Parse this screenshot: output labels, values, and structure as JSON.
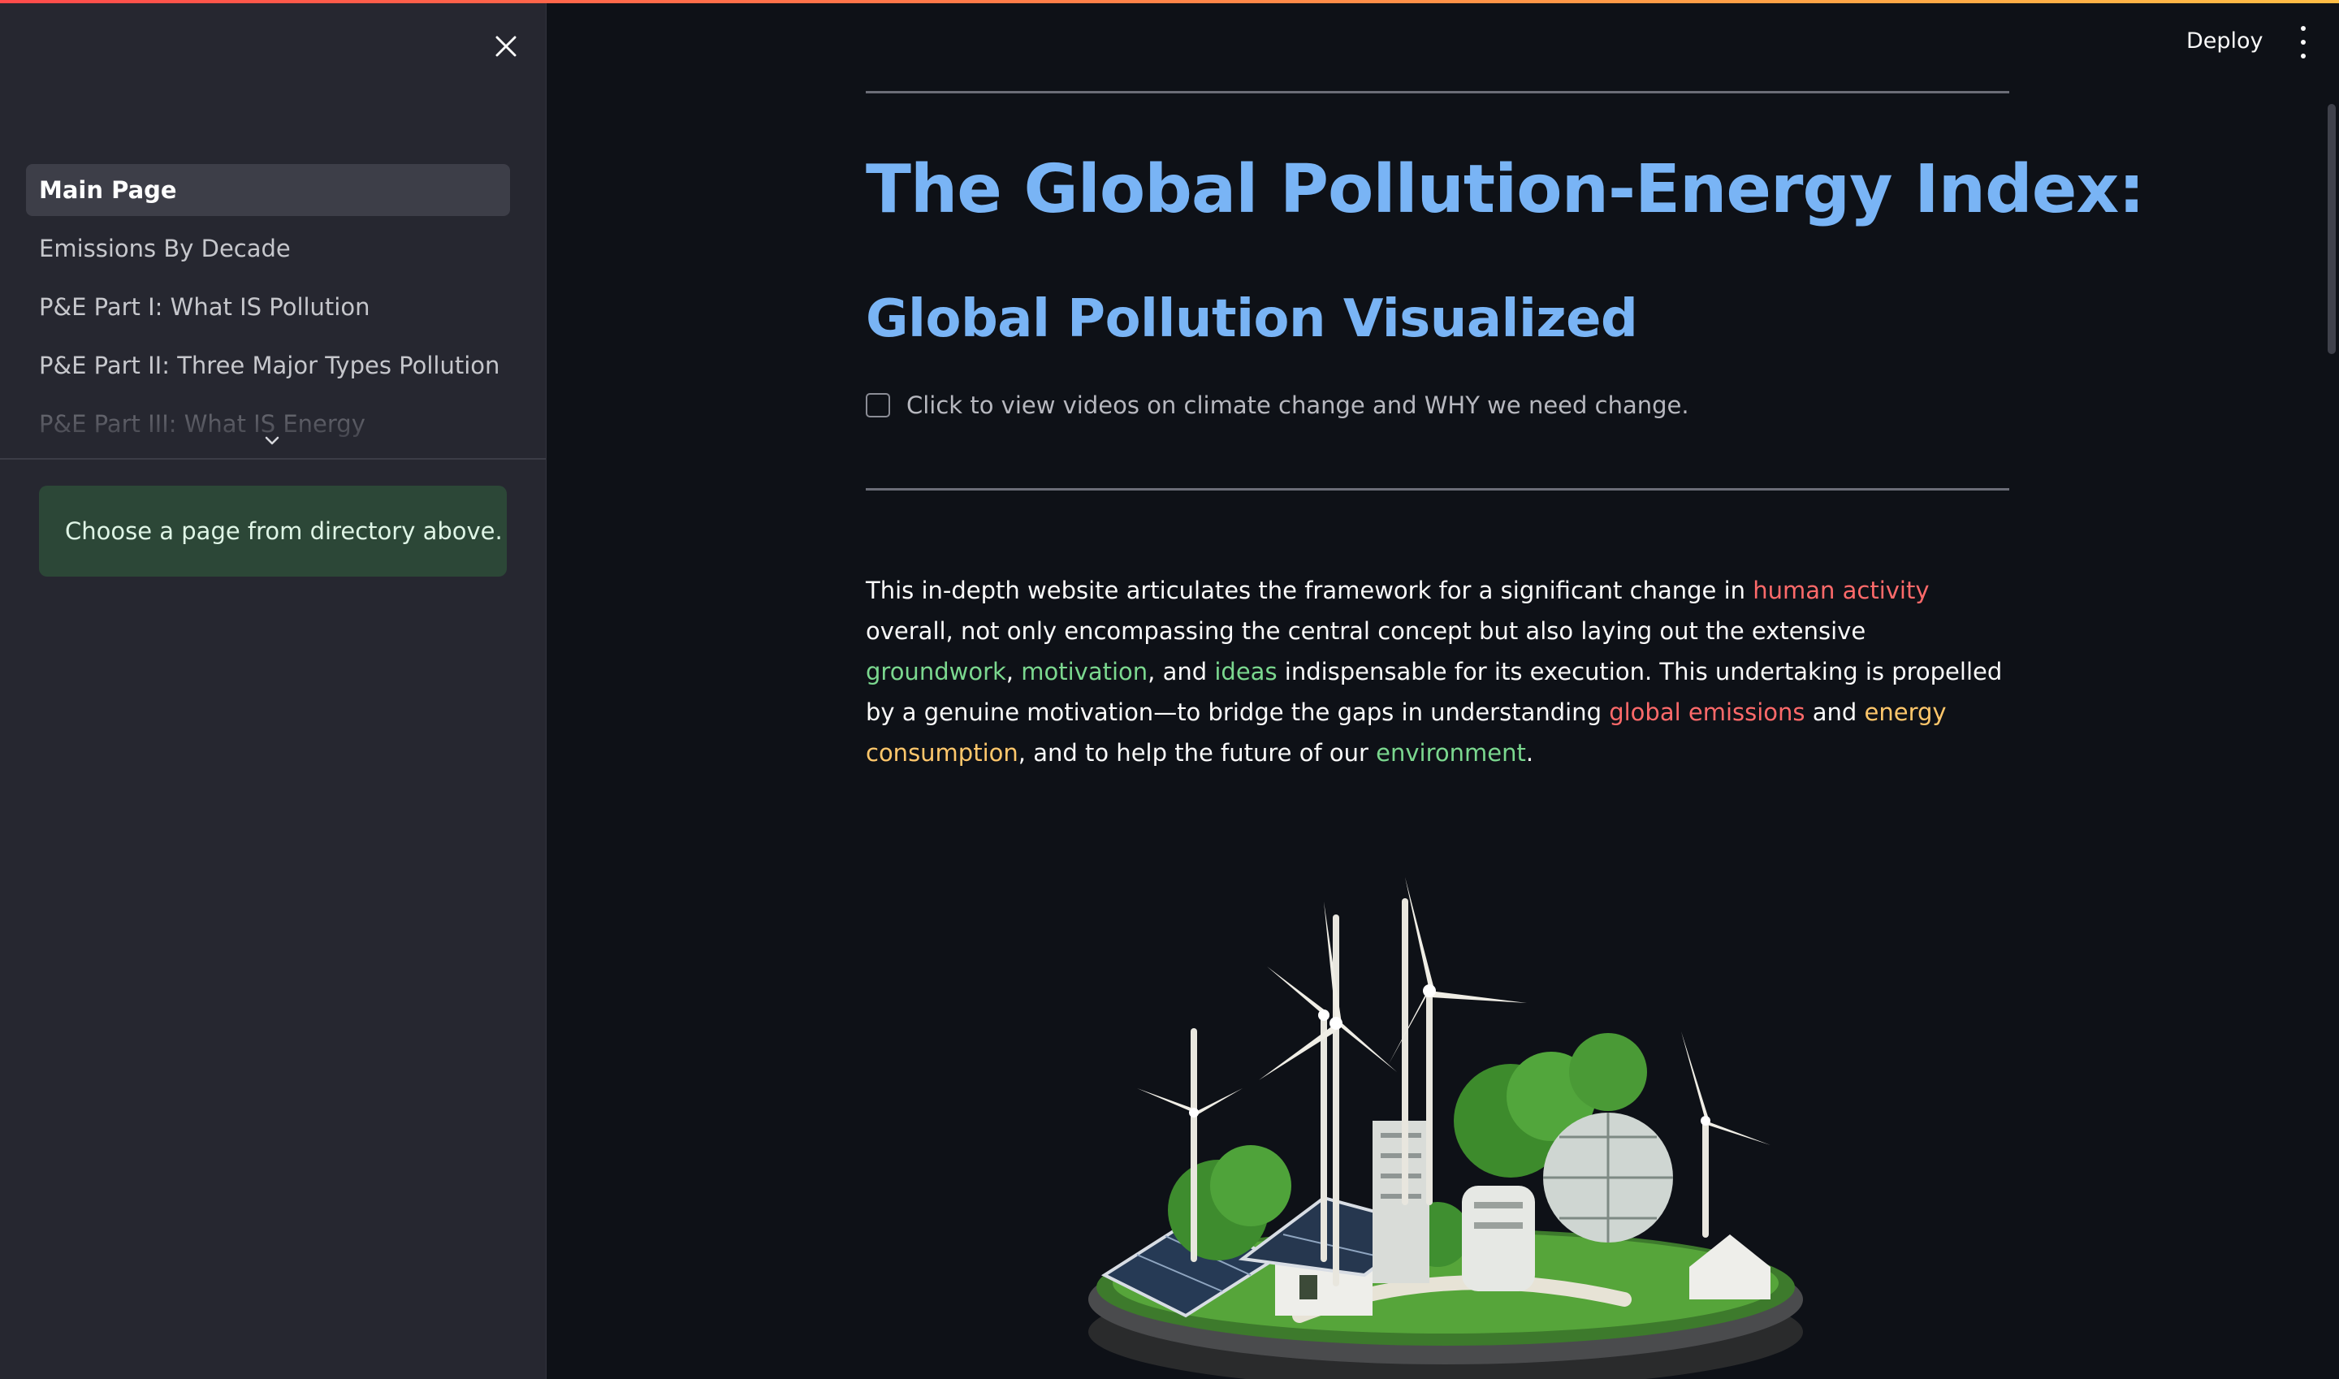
{
  "sidebar": {
    "nav_items": [
      {
        "label": "Main Page"
      },
      {
        "label": "Emissions By Decade"
      },
      {
        "label": "P&E Part I: What IS Pollution"
      },
      {
        "label": "P&E Part II: Three Major Types Pollution"
      },
      {
        "label": "P&E Part III: What IS Energy"
      }
    ],
    "info_message": "Choose a page from directory above."
  },
  "header": {
    "deploy_label": "Deploy"
  },
  "main": {
    "title": "The Global Pollution-Energy Index:",
    "subtitle": "Global Pollution Visualized",
    "checkbox_label": "Click to view videos on climate change and WHY we need change.",
    "intro": {
      "p1": "This in-depth website articulates the framework for a significant change in ",
      "h1": "human activity",
      "p2": " overall, not only encompassing the central concept but also laying out the extensive ",
      "h2": "groundwork",
      "p3": ", ",
      "h3": "motivation",
      "p4": ", and ",
      "h4": "ideas",
      "p5": " indispensable for its execution. This undertaking is propelled by a genuine motivation—to bridge the gaps in understanding ",
      "h5": "global emissions",
      "p6": " and ",
      "h6": "energy consumption",
      "p7": ", and to help the future of our ",
      "h7": "environment",
      "p8": "."
    }
  },
  "colors": {
    "accent_blue": "#79b4f5",
    "highlight_red": "#ff6a6a",
    "highlight_green": "#7bd88f",
    "highlight_yellow": "#ffc76b",
    "info_box_bg": "#2c4737"
  },
  "icons": {
    "close": "close-icon",
    "expand": "chevron-down-icon",
    "menu": "kebab-menu-icon"
  }
}
